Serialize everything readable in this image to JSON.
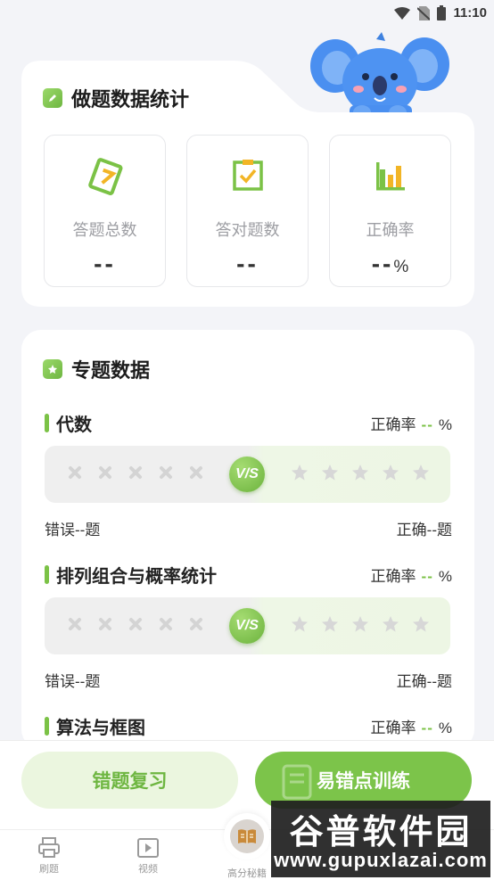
{
  "status_bar": {
    "time": "11:10"
  },
  "stats": {
    "title": "做题数据统计",
    "items": [
      {
        "label": "答题总数",
        "value": "--",
        "unit": ""
      },
      {
        "label": "答对题数",
        "value": "--",
        "unit": ""
      },
      {
        "label": "正确率",
        "value": "--",
        "unit": "%"
      }
    ]
  },
  "topics": {
    "title": "专题数据",
    "accuracy_label": "正确率",
    "accuracy_value": "--",
    "accuracy_unit": "%",
    "ratio_badge": "V/S",
    "items": [
      {
        "name": "代数",
        "wrong": "错误--题",
        "correct": "正确--题"
      },
      {
        "name": "排列组合与概率统计",
        "wrong": "错误--题",
        "correct": "正确--题"
      },
      {
        "name": "算法与框图"
      }
    ]
  },
  "actions": {
    "review": "错题复习",
    "train": "易错点训练"
  },
  "tabs": [
    {
      "label": "刷题",
      "icon": "printer-icon"
    },
    {
      "label": "视频",
      "icon": "video-icon"
    },
    {
      "label": "高分秘籍",
      "icon": "book-icon"
    }
  ],
  "watermark": {
    "title": "谷普软件园",
    "url": "www.gupuxlazai.com"
  },
  "colors": {
    "accent": "#7bc246",
    "accent_light": "#ebf6df",
    "koala": "#4a8ff0"
  }
}
